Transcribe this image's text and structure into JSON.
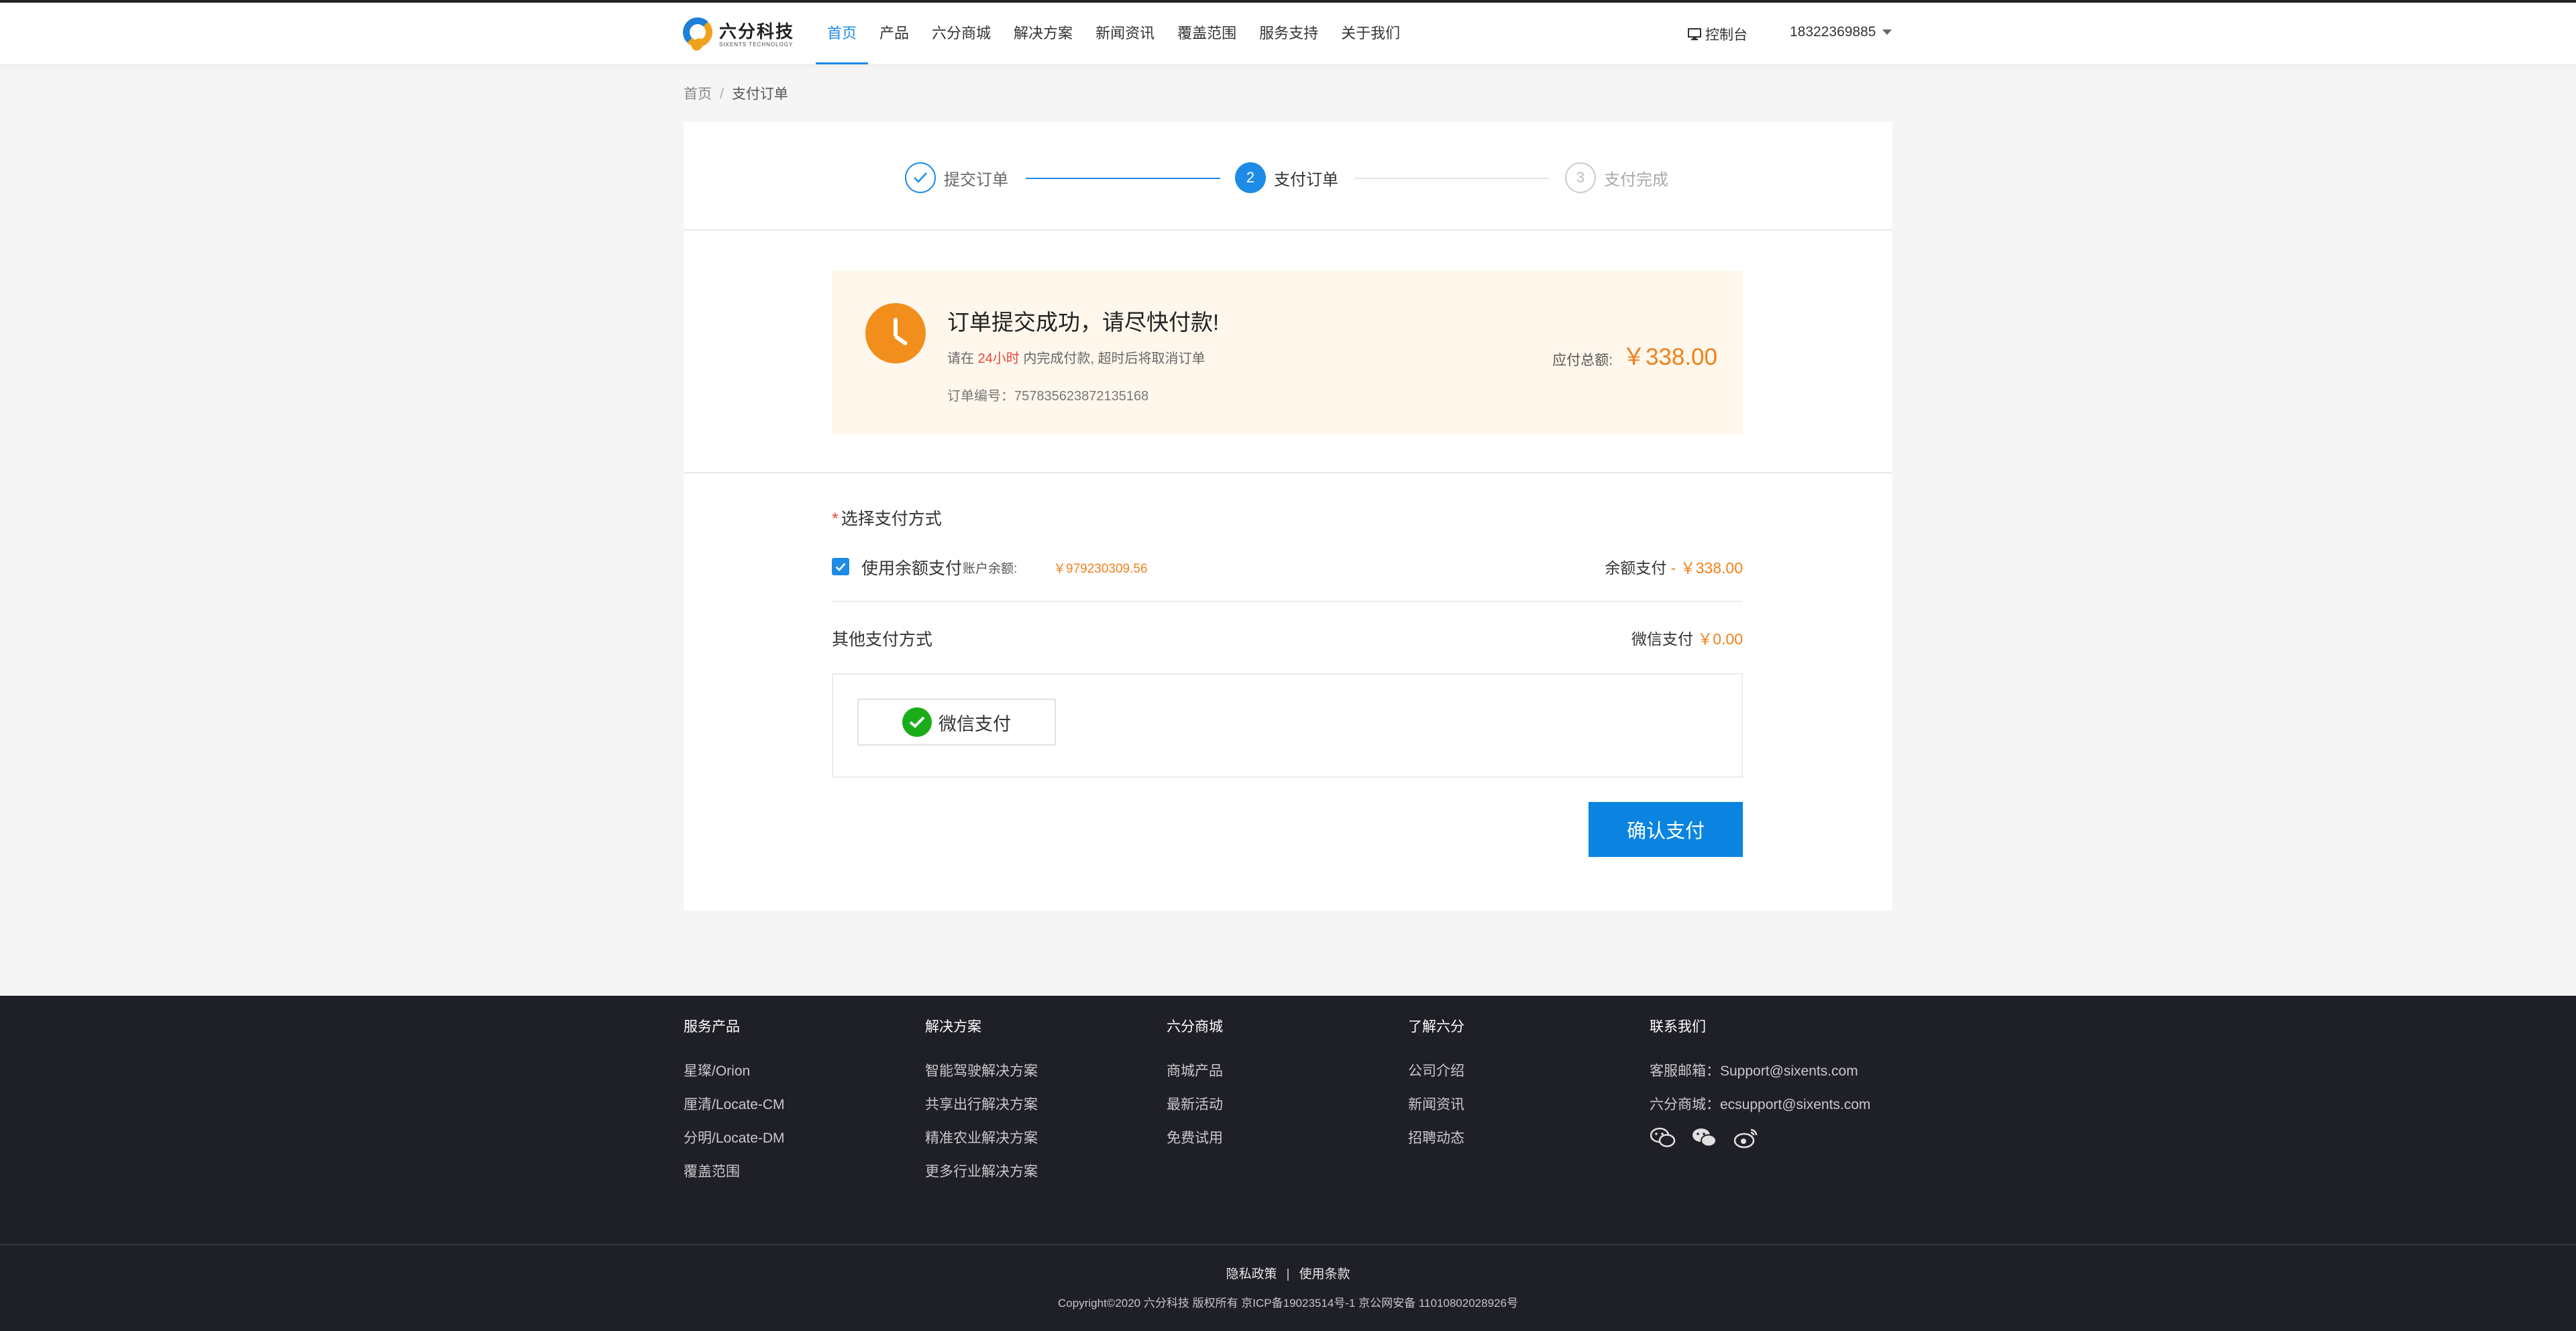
{
  "header": {
    "logo_cn": "六分科技",
    "logo_en": "SIXENTS TECHNOLOGY",
    "nav": [
      "首页",
      "产品",
      "六分商城",
      "解决方案",
      "新闻资讯",
      "覆盖范围",
      "服务支持",
      "关于我们"
    ],
    "active_nav": "首页",
    "console": "控制台",
    "user": "18322369885"
  },
  "breadcrumb": {
    "home": "首页",
    "sep": "/",
    "current": "支付订单"
  },
  "steps": [
    {
      "num": "",
      "label": "提交订单",
      "state": "done"
    },
    {
      "num": "2",
      "label": "支付订单",
      "state": "active"
    },
    {
      "num": "3",
      "label": "支付完成",
      "state": "pending"
    }
  ],
  "notice": {
    "title": "订单提交成功，请尽快付款!",
    "desc_prefix": "请在",
    "desc_highlight": "24小时",
    "desc_suffix": "内完成付款, 超时后将取消订单",
    "order_label": "订单编号：",
    "order_no": "757835623872135168",
    "amount_label": "应付总额:",
    "amount": "￥338.00"
  },
  "payment": {
    "title_required": "*",
    "title": "选择支付方式",
    "balance_label": "使用余额支付",
    "balance_checked": true,
    "account_label": "账户余额:",
    "account_value": "￥979230309.56",
    "balance_pay_label": "余额支付",
    "balance_pay_value": "- ￥338.00",
    "other_title": "其他支付方式",
    "wechat_pay_label": "微信支付",
    "wechat_pay_value": "￥0.00",
    "wechat_option": "微信支付",
    "confirm": "确认支付"
  },
  "footer": {
    "columns": [
      {
        "title": "服务产品",
        "items": [
          "星璨/Orion",
          "厘清/Locate-CM",
          "分明/Locate-DM",
          "覆盖范围"
        ]
      },
      {
        "title": "解决方案",
        "items": [
          "智能驾驶解决方案",
          "共享出行解决方案",
          "精准农业解决方案",
          "更多行业解决方案"
        ]
      },
      {
        "title": "六分商城",
        "items": [
          "商城产品",
          "最新活动",
          "免费试用"
        ]
      },
      {
        "title": "了解六分",
        "items": [
          "公司介绍",
          "新闻资讯",
          "招聘动态"
        ]
      },
      {
        "title": "联系我们",
        "items": [
          "客服邮箱：Support@sixents.com",
          "六分商城：ecsupport@sixents.com"
        ]
      }
    ],
    "social_icons": [
      "wechat-icon",
      "wechat-group-icon",
      "weibo-icon"
    ],
    "links": [
      "隐私政策",
      "使用条款"
    ],
    "copyright": "Copyright©2020 六分科技 版权所有 京ICP备19023514号-1 京公网安备 11010802028926号"
  },
  "colors": {
    "primary": "#1e8be6",
    "accent_orange": "#f0801a",
    "footer_bg": "#1f2027",
    "notice_bg": "#fff7ec"
  }
}
